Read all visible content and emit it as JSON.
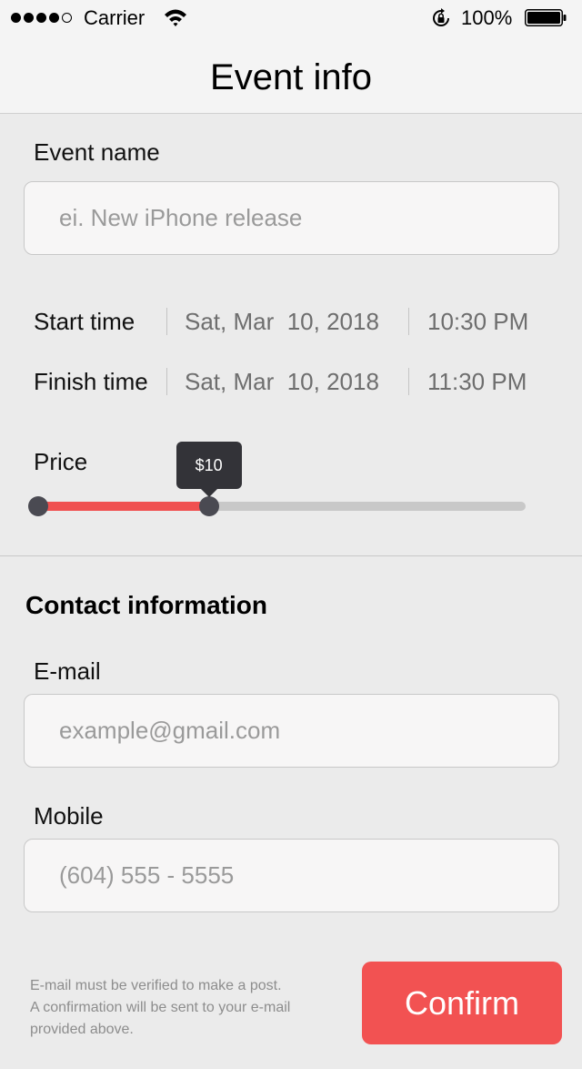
{
  "status_bar": {
    "carrier": "Carrier",
    "battery_percent": "100%",
    "signal_bars_filled": 4,
    "signal_bars_total": 5,
    "battery_level": 1.0
  },
  "nav": {
    "title": "Event info"
  },
  "event_name": {
    "label": "Event name",
    "placeholder": "ei. New iPhone release",
    "value": ""
  },
  "start_time": {
    "label": "Start time",
    "date": "Sat, Mar  10, 2018",
    "time": "10:30 PM"
  },
  "finish_time": {
    "label": "Finish time",
    "date": "Sat, Mar  10, 2018",
    "time": "11:30 PM"
  },
  "price": {
    "label": "Price",
    "tooltip": "$10",
    "fraction": 0.35
  },
  "contact": {
    "title": "Contact information",
    "email": {
      "label": "E-mail",
      "placeholder": "example@gmail.com",
      "value": ""
    },
    "mobile": {
      "label": "Mobile",
      "placeholder": "(604) 555 - 5555",
      "value": ""
    }
  },
  "footer": {
    "note_lines": [
      "E-mail must be verified to make a post.",
      "A confirmation will be sent to your e-mail",
      "provided above."
    ],
    "confirm_label": "Confirm"
  },
  "colors": {
    "accent": "#f25252",
    "slider_fill": "#f05050",
    "knob": "#4a4a52",
    "tooltip_bg": "#333338"
  },
  "icons": {
    "wifi": "wifi-icon",
    "rotation_lock": "rotation-lock-icon",
    "battery": "battery-icon"
  }
}
